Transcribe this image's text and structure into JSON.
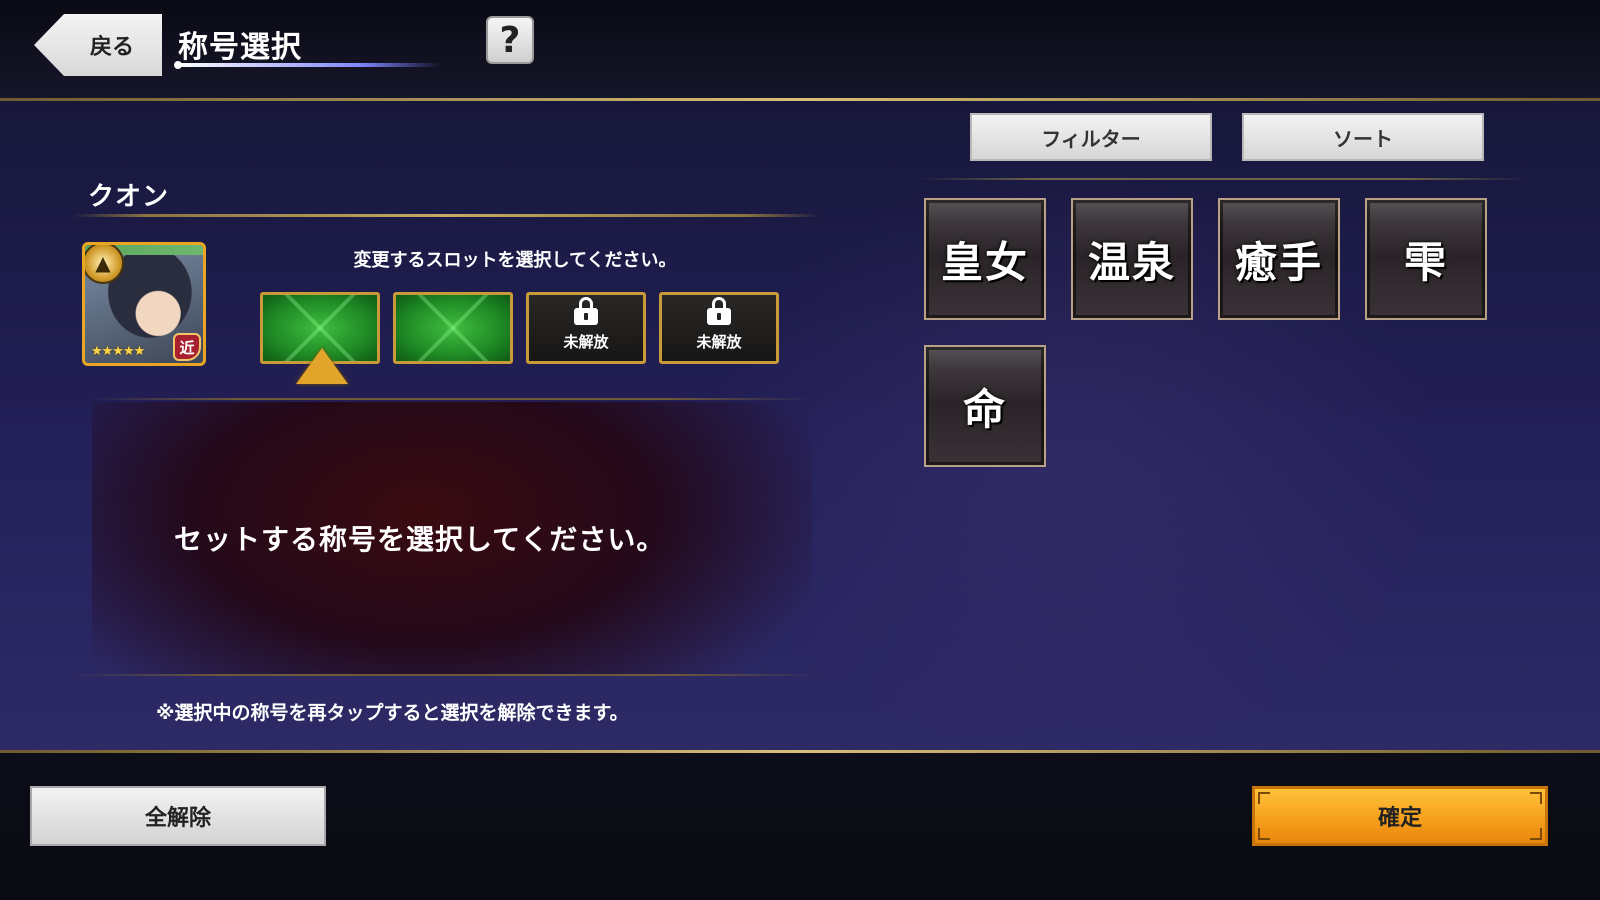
{
  "header": {
    "back_label": "戻る",
    "title": "称号選択",
    "help_label": "?"
  },
  "toolbar": {
    "filter_label": "フィルター",
    "sort_label": "ソート"
  },
  "character": {
    "name": "クオン",
    "role_badge": "近",
    "stars": "★★★★★"
  },
  "slots": {
    "prompt": "変更するスロットを選択してください。",
    "items": [
      {
        "state": "empty"
      },
      {
        "state": "empty"
      },
      {
        "state": "locked",
        "label": "未解放"
      },
      {
        "state": "locked",
        "label": "未解放"
      }
    ]
  },
  "detail": {
    "text": "セットする称号を選択してください。",
    "note": "※選択中の称号を再タップすると選択を解除できます。"
  },
  "titles": [
    "皇女",
    "温泉",
    "癒手",
    "雫",
    "命"
  ],
  "footer": {
    "clear_label": "全解除",
    "confirm_label": "確定"
  }
}
